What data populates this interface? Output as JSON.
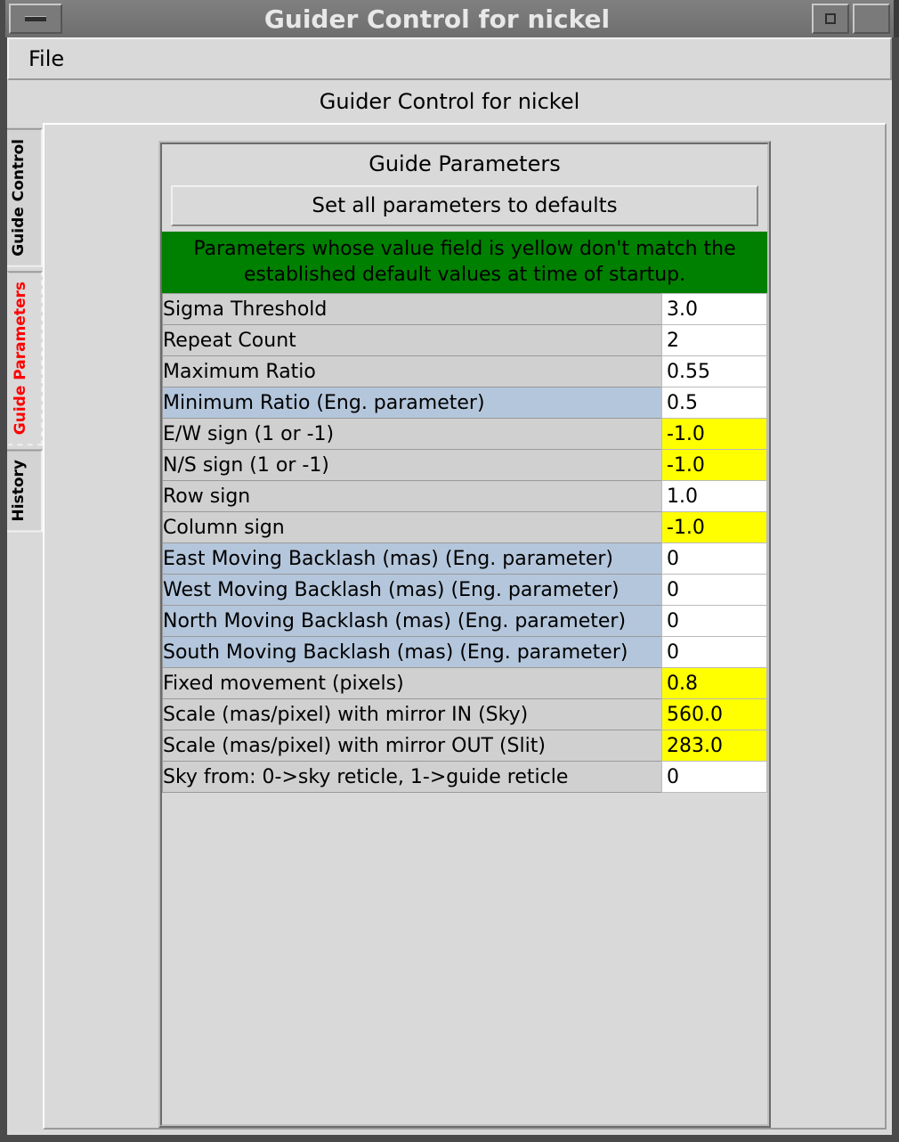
{
  "window": {
    "title": "Guider Control for nickel"
  },
  "menubar": {
    "file": "File"
  },
  "header": "Guider Control for nickel",
  "tabs": {
    "guide_control": "Guide Control",
    "guide_parameters": "Guide Parameters",
    "history": "History"
  },
  "panel": {
    "title": "Guide Parameters",
    "defaults_button": "Set all parameters to defaults",
    "hint": "Parameters whose value field is yellow don't match the established default values at time of startup."
  },
  "params": [
    {
      "label": "Sigma Threshold",
      "value": "3.0",
      "eng": false,
      "yellow": false
    },
    {
      "label": "Repeat Count",
      "value": "2",
      "eng": false,
      "yellow": false
    },
    {
      "label": "Maximum Ratio",
      "value": "0.55",
      "eng": false,
      "yellow": false
    },
    {
      "label": "Minimum Ratio (Eng. parameter)",
      "value": "0.5",
      "eng": true,
      "yellow": false
    },
    {
      "label": "E/W sign (1 or -1)",
      "value": "-1.0",
      "eng": false,
      "yellow": true
    },
    {
      "label": "N/S sign (1 or -1)",
      "value": "-1.0",
      "eng": false,
      "yellow": true
    },
    {
      "label": "Row sign",
      "value": "1.0",
      "eng": false,
      "yellow": false
    },
    {
      "label": "Column sign",
      "value": "-1.0",
      "eng": false,
      "yellow": true
    },
    {
      "label": "East Moving Backlash (mas) (Eng. parameter)",
      "value": "0",
      "eng": true,
      "yellow": false
    },
    {
      "label": "West Moving Backlash (mas) (Eng. parameter)",
      "value": "0",
      "eng": true,
      "yellow": false
    },
    {
      "label": "North Moving Backlash (mas) (Eng. parameter)",
      "value": "0",
      "eng": true,
      "yellow": false
    },
    {
      "label": "South Moving Backlash (mas) (Eng. parameter)",
      "value": "0",
      "eng": true,
      "yellow": false
    },
    {
      "label": "Fixed movement (pixels)",
      "value": "0.8",
      "eng": false,
      "yellow": true
    },
    {
      "label": "Scale (mas/pixel) with mirror IN (Sky)",
      "value": "560.0",
      "eng": false,
      "yellow": true
    },
    {
      "label": "Scale (mas/pixel) with mirror OUT (Slit)",
      "value": "283.0",
      "eng": false,
      "yellow": true
    },
    {
      "label": "Sky from: 0->sky reticle, 1->guide reticle",
      "value": "0",
      "eng": false,
      "yellow": false
    }
  ]
}
